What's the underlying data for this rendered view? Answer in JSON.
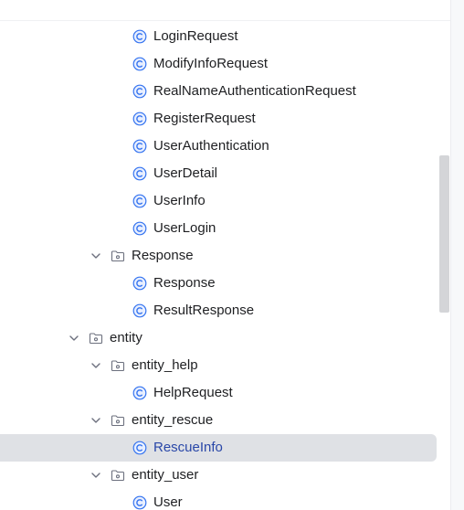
{
  "project_tree": {
    "rows": [
      {
        "label": "LoginRequest",
        "kind": "class",
        "indent": 2
      },
      {
        "label": "ModifyInfoRequest",
        "kind": "class",
        "indent": 2
      },
      {
        "label": "RealNameAuthenticationRequest",
        "kind": "class",
        "indent": 2
      },
      {
        "label": "RegisterRequest",
        "kind": "class",
        "indent": 2
      },
      {
        "label": "UserAuthentication",
        "kind": "class",
        "indent": 2
      },
      {
        "label": "UserDetail",
        "kind": "class",
        "indent": 2
      },
      {
        "label": "UserInfo",
        "kind": "class",
        "indent": 2
      },
      {
        "label": "UserLogin",
        "kind": "class",
        "indent": 2
      },
      {
        "label": "Response",
        "kind": "package",
        "indent": 1,
        "expanded": true
      },
      {
        "label": "Response",
        "kind": "class",
        "indent": 2
      },
      {
        "label": "ResultResponse",
        "kind": "class",
        "indent": 2
      },
      {
        "label": "entity",
        "kind": "package",
        "indent": 0,
        "expanded": true
      },
      {
        "label": "entity_help",
        "kind": "package",
        "indent": 1,
        "expanded": true
      },
      {
        "label": "HelpRequest",
        "kind": "class",
        "indent": 2
      },
      {
        "label": "entity_rescue",
        "kind": "package",
        "indent": 1,
        "expanded": true
      },
      {
        "label": "RescueInfo",
        "kind": "class",
        "indent": 2,
        "selected": true
      },
      {
        "label": "entity_user",
        "kind": "package",
        "indent": 1,
        "expanded": true
      },
      {
        "label": "User",
        "kind": "class",
        "indent": 2
      }
    ]
  },
  "colors": {
    "class_icon": "#3574f0",
    "folder_icon": "#6c707e",
    "selected_row_bg": "#dfe1e5",
    "selected_text": "#2947a8"
  }
}
